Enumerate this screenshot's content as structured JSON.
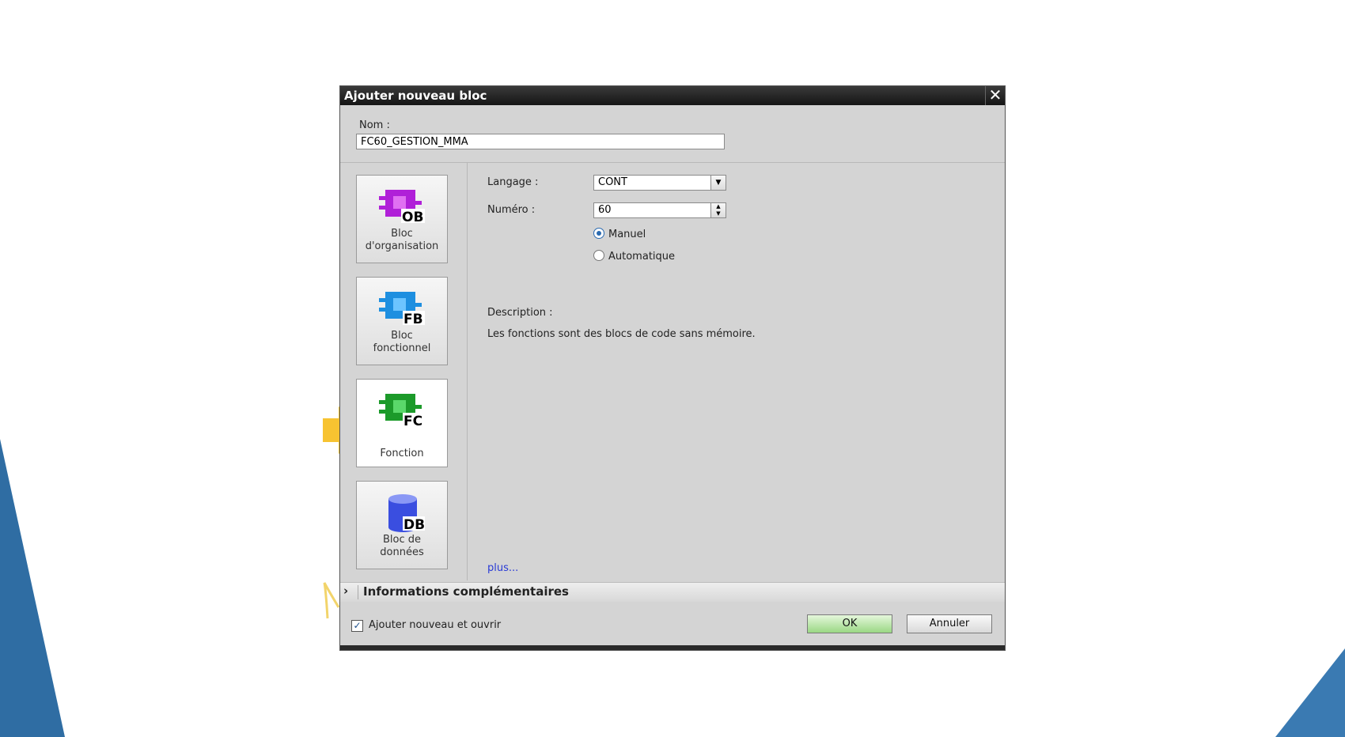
{
  "dialog": {
    "title": "Ajouter nouveau bloc",
    "close_icon": "close-icon"
  },
  "name": {
    "label": "Nom :",
    "value": "FC60_GESTION_MMA"
  },
  "block_types": [
    {
      "icon_text": "OB",
      "label_line1": "Bloc",
      "label_line2": "d'organisation",
      "color": "#b020d8"
    },
    {
      "icon_text": "FB",
      "label_line1": "Bloc",
      "label_line2": "fonctionnel",
      "color": "#1e8fe0"
    },
    {
      "icon_text": "FC",
      "label_line1": "Fonction",
      "label_line2": "",
      "color": "#1c9a2a",
      "selected": true
    },
    {
      "icon_text": "DB",
      "label_line1": "Bloc de",
      "label_line2": "données",
      "color": "#3a4ee0"
    }
  ],
  "language": {
    "label": "Langage :",
    "value": "CONT"
  },
  "number": {
    "label": "Numéro :",
    "value": "60"
  },
  "numbering": {
    "manual": "Manuel",
    "automatic": "Automatique",
    "selected": "manual"
  },
  "description": {
    "label": "Description :",
    "text": "Les fonctions sont des blocs de code sans mémoire."
  },
  "more_link": "plus...",
  "info_section": "Informations complémentaires",
  "footer": {
    "add_open_label": "Ajouter nouveau et ouvrir",
    "add_open_checked": true,
    "ok_label": "OK",
    "cancel_label": "Annuler"
  },
  "colors": {
    "accent_blue": "#2f6da3",
    "arrow_yellow": "#f7c331"
  }
}
